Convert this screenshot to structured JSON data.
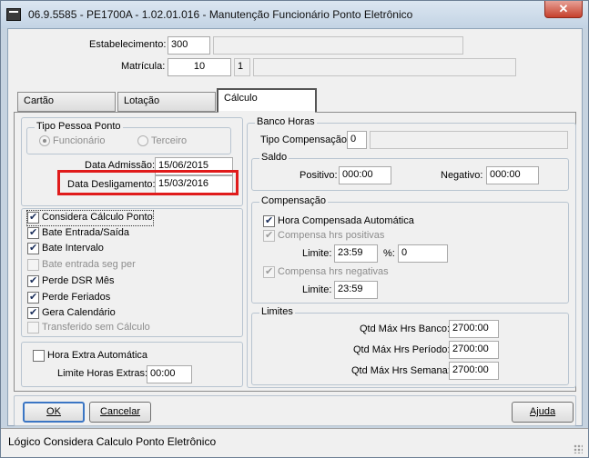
{
  "window": {
    "title": "06.9.5585 - PE1700A - 1.02.01.016 - Manutenção Funcionário Ponto Eletrônico",
    "close_glyph": "✕"
  },
  "header": {
    "estabelecimento_label": "Estabelecimento:",
    "estabelecimento_value": "300",
    "estabelecimento_desc": "",
    "matricula_label": "Matrícula:",
    "matricula_value": "10",
    "matricula_digit": "1",
    "matricula_desc": ""
  },
  "tabs": [
    {
      "label": "Cartão",
      "active": false
    },
    {
      "label": "Lotação",
      "active": false
    },
    {
      "label": "Cálculo",
      "active": true
    }
  ],
  "tipo_pessoa": {
    "title": "Tipo Pessoa Ponto",
    "option_funcionario": "Funcionário",
    "option_terceiro": "Terceiro",
    "selected": "Funcionário"
  },
  "datas": {
    "admissao_label": "Data Admissão:",
    "admissao_value": "15/06/2015",
    "desligamento_label": "Data Desligamento:",
    "desligamento_value": "15/03/2016"
  },
  "options": [
    {
      "label": "Considera Cálculo Ponto",
      "checked": true,
      "enabled": true
    },
    {
      "label": "Bate Entrada/Saída",
      "checked": true,
      "enabled": true
    },
    {
      "label": "Bate Intervalo",
      "checked": true,
      "enabled": true
    },
    {
      "label": "Bate entrada seg per",
      "checked": false,
      "enabled": false
    },
    {
      "label": "Perde DSR Mês",
      "checked": true,
      "enabled": true
    },
    {
      "label": "Perde Feriados",
      "checked": true,
      "enabled": true
    },
    {
      "label": "Gera Calendário",
      "checked": true,
      "enabled": true
    },
    {
      "label": "Transferido sem Cálculo",
      "checked": false,
      "enabled": false
    }
  ],
  "hora_extra": {
    "checkbox_label": "Hora Extra Automática",
    "limite_label": "Limite Horas Extras:",
    "limite_value": "00:00"
  },
  "banco_horas": {
    "title": "Banco Horas",
    "tipo_label": "Tipo Compensação:",
    "tipo_value": "0",
    "tipo_desc": ""
  },
  "saldo": {
    "title": "Saldo",
    "positivo_label": "Positivo:",
    "positivo_value": "000:00",
    "negativo_label": "Negativo:",
    "negativo_value": "000:00"
  },
  "compensacao": {
    "title": "Compensação",
    "hora_auto_label": "Hora Compensada Automática",
    "positivas_label": "Compensa hrs positivas",
    "limite1_label": "Limite:",
    "limite1_value": "23:59",
    "percent_label": "%:",
    "percent_value": "0",
    "negativas_label": "Compensa hrs negativas",
    "limite2_label": "Limite:",
    "limite2_value": "23:59"
  },
  "limites": {
    "title": "Limites",
    "banco_label": "Qtd Máx Hrs Banco:",
    "banco_value": "2700:00",
    "periodo_label": "Qtd Máx Hrs Período:",
    "periodo_value": "2700:00",
    "semana_label": "Qtd Máx Hrs Semana:",
    "semana_value": "2700:00"
  },
  "buttons": {
    "ok": "OK",
    "cancelar": "Cancelar",
    "ajuda": "Ajuda"
  },
  "status": {
    "text": "Lógico Considera Calculo Ponto Eletrônico"
  },
  "colors": {
    "highlight": "#e01b1b",
    "close_button": "#c6402c"
  }
}
